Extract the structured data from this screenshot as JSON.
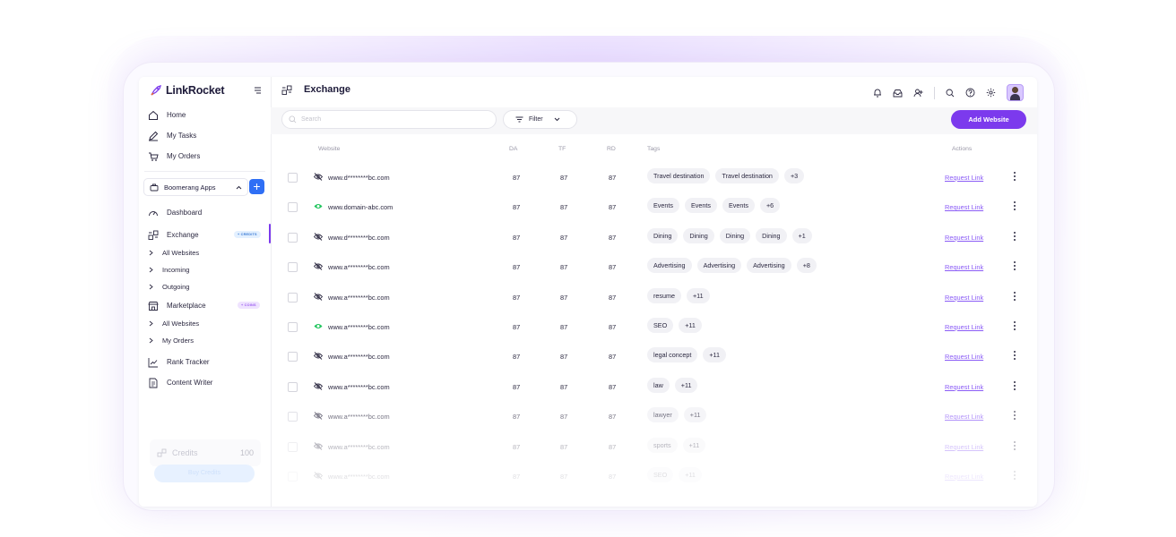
{
  "app": {
    "logo_text": "LinkRocket"
  },
  "nav_top": [
    {
      "label": "Home",
      "icon": "home-icon"
    },
    {
      "label": "My Tasks",
      "icon": "pencil-icon"
    },
    {
      "label": "My Orders",
      "icon": "cart-icon"
    }
  ],
  "workspace": {
    "label": "Boomerang Apps"
  },
  "nav_apps": {
    "dashboard": "Dashboard",
    "exchange": "Exchange",
    "exchange_badge": "+ CREDITS",
    "exchange_sub": [
      "All Websites",
      "Incoming",
      "Outgoing"
    ],
    "marketplace": "Marketplace",
    "marketplace_badge": "+ COINS",
    "marketplace_sub": [
      "All Websites",
      "My Orders"
    ],
    "rank_tracker": "Rank Tracker",
    "content_writer": "Content Writer"
  },
  "credits": {
    "label": "Credits",
    "value": "100",
    "buy_label": "Buy Credits"
  },
  "header": {
    "title": "Exchange"
  },
  "toolbar": {
    "search_placeholder": "Search",
    "filter_label": "Filter",
    "add_label": "Add Website"
  },
  "table": {
    "columns": {
      "website": "Website",
      "da": "DA",
      "tf": "TF",
      "rd": "RD",
      "tags": "Tags",
      "actions": "Actions"
    },
    "action_label": "Request Link",
    "rows": [
      {
        "site": "www.d********bc.com",
        "visible": false,
        "da": "87",
        "tf": "87",
        "rd": "87",
        "tags": [
          "Travel destination",
          "Travel destination"
        ],
        "more": "+3"
      },
      {
        "site": "www.domain-abc.com",
        "visible": true,
        "da": "87",
        "tf": "87",
        "rd": "87",
        "tags": [
          "Events",
          "Events",
          "Events"
        ],
        "more": "+6"
      },
      {
        "site": "www.d********bc.com",
        "visible": false,
        "da": "87",
        "tf": "87",
        "rd": "87",
        "tags": [
          "Dining",
          "Dining",
          "Dining",
          "Dining"
        ],
        "more": "+1"
      },
      {
        "site": "www.a********bc.com",
        "visible": false,
        "da": "87",
        "tf": "87",
        "rd": "87",
        "tags": [
          "Advertising",
          "Advertising",
          "Advertising"
        ],
        "more": "+8"
      },
      {
        "site": "www.a********bc.com",
        "visible": false,
        "da": "87",
        "tf": "87",
        "rd": "87",
        "tags": [
          "resume"
        ],
        "more": "+11"
      },
      {
        "site": "www.a********bc.com",
        "visible": true,
        "da": "87",
        "tf": "87",
        "rd": "87",
        "tags": [
          "SEO"
        ],
        "more": "+11"
      },
      {
        "site": "www.a********bc.com",
        "visible": false,
        "da": "87",
        "tf": "87",
        "rd": "87",
        "tags": [
          "legal concept"
        ],
        "more": "+11"
      },
      {
        "site": "www.a********bc.com",
        "visible": false,
        "da": "87",
        "tf": "87",
        "rd": "87",
        "tags": [
          "law"
        ],
        "more": "+11"
      },
      {
        "site": "www.a********bc.com",
        "visible": false,
        "da": "87",
        "tf": "87",
        "rd": "87",
        "tags": [
          "lawyer"
        ],
        "more": "+11"
      },
      {
        "site": "www.a********bc.com",
        "visible": false,
        "da": "87",
        "tf": "87",
        "rd": "87",
        "tags": [
          "sports"
        ],
        "more": "+11"
      },
      {
        "site": "www.a********bc.com",
        "visible": false,
        "da": "87",
        "tf": "87",
        "rd": "87",
        "tags": [
          "SEO"
        ],
        "more": "+11"
      }
    ]
  },
  "colors": {
    "accent": "#7c3aed",
    "primary_blue": "#2f6ff5",
    "link": "#8b5cf6",
    "eye_visible": "#22c55e"
  }
}
